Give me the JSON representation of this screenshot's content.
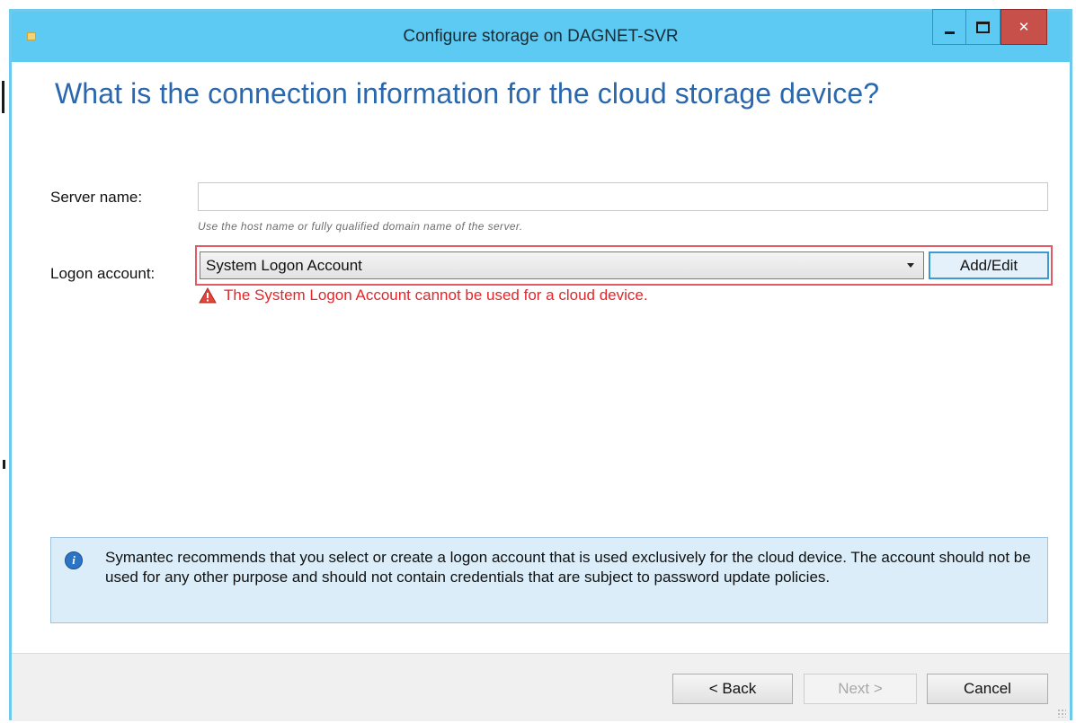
{
  "window": {
    "title": "Configure storage on DAGNET-SVR"
  },
  "page": {
    "heading": "What is the connection information for the cloud storage device?"
  },
  "form": {
    "server_label": "Server name:",
    "server_value": "",
    "server_hint": "Use the host name or fully qualified domain name of the server.",
    "logon_label": "Logon account:",
    "logon_selected": "System Logon Account",
    "add_edit_label": "Add/Edit",
    "error_message": "The System Logon Account cannot be used for a cloud device."
  },
  "info": {
    "text": "Symantec recommends that you select or create a logon account that is used exclusively for the cloud device. The account should not be used for any other purpose and should not contain credentials that are subject to password update policies."
  },
  "footer": {
    "back_label": "< Back",
    "next_label": "Next >",
    "cancel_label": "Cancel"
  },
  "colors": {
    "titlebar": "#5ccaf2",
    "heading": "#2a67ad",
    "error": "#e4262a",
    "highlight_border": "#e35a67",
    "info_background": "#daedf8"
  },
  "icons": {
    "app": "app-icon",
    "warning": "warning-icon",
    "info": "info-icon",
    "dropdown": "chevron-down-icon"
  }
}
